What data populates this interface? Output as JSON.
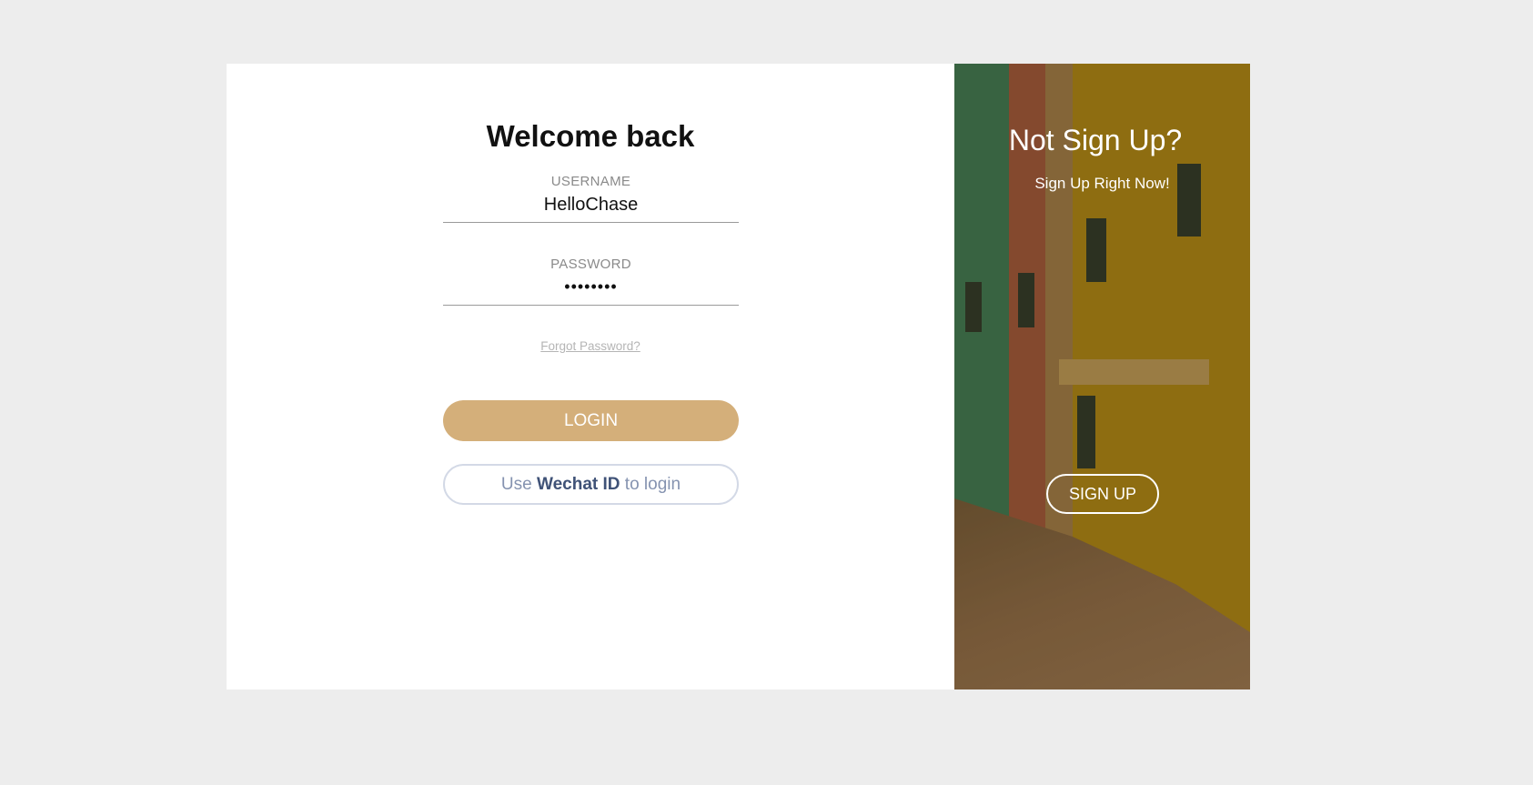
{
  "login": {
    "title": "Welcome back",
    "username_label": "USERNAME",
    "username_value": "HelloChase",
    "password_label": "PASSWORD",
    "password_value": "••••••••",
    "forgot_label": "Forgot Password?",
    "login_button": "LOGIN",
    "wechat": {
      "prefix": "Use",
      "bold": "Wechat ID",
      "suffix": "to login"
    }
  },
  "promo": {
    "title": "Not Sign Up?",
    "subtitle": "Sign Up Right Now!",
    "signup_button": "SIGN UP"
  },
  "colors": {
    "login_button": "#d4af7a",
    "wechat_border": "#d3d9e6",
    "background": "#ededed"
  }
}
